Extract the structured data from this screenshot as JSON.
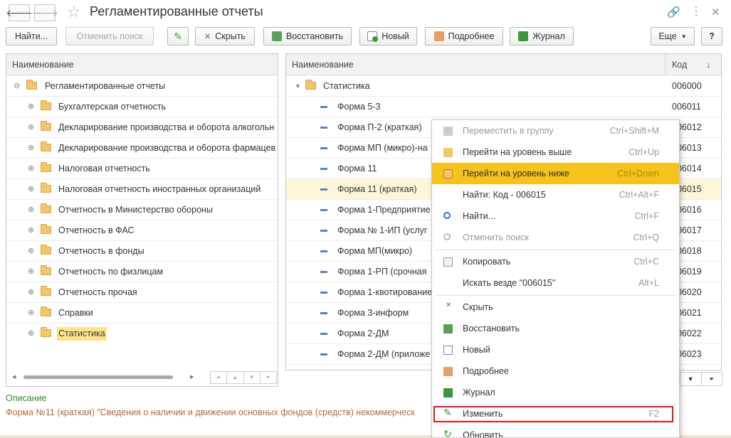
{
  "window": {
    "title": "Регламентированные отчеты"
  },
  "toolbar": {
    "find": "Найти...",
    "cancel_search": "Отменить поиск",
    "hide": "Скрыть",
    "restore": "Восстановить",
    "new": "Новый",
    "details": "Подробнее",
    "journal": "Журнал",
    "more": "Еще",
    "help": "?"
  },
  "left_tree": {
    "header": "Наименование",
    "items": [
      {
        "label": "Регламентированные отчеты"
      },
      {
        "label": "Бухгалтерская отчетность"
      },
      {
        "label": "Декларирование производства и оборота алкогольн"
      },
      {
        "label": "Декларирование производства и оборота фармацев"
      },
      {
        "label": "Налоговая отчетность"
      },
      {
        "label": "Налоговая отчетность иностранных организаций"
      },
      {
        "label": "Отчетность в Министерство обороны"
      },
      {
        "label": "Отчетность в ФАС"
      },
      {
        "label": "Отчетность в фонды"
      },
      {
        "label": "Отчетность по физлицам"
      },
      {
        "label": "Отчетность прочая"
      },
      {
        "label": "Справки"
      },
      {
        "label": "Статистика"
      }
    ]
  },
  "right_list": {
    "header_name": "Наименование",
    "header_code": "Код",
    "sort_icon": "↓",
    "rows": [
      {
        "name": "Статистика",
        "code": "006000"
      },
      {
        "name": "Форма 5-3",
        "code": "006011"
      },
      {
        "name": "Форма П-2 (краткая)",
        "code": "006012"
      },
      {
        "name": "Форма МП (микро)-на",
        "code": "006013"
      },
      {
        "name": "Форма 11",
        "code": "006014"
      },
      {
        "name": "Форма 11 (краткая)",
        "code": "006015"
      },
      {
        "name": "Форма 1-Предприятие",
        "code": "006016"
      },
      {
        "name": "Форма № 1-ИП (услуг",
        "code": "006017"
      },
      {
        "name": "Форма МП(микро)",
        "code": "006018"
      },
      {
        "name": "Форма 1-РП (срочная",
        "code": "006019"
      },
      {
        "name": "Форма 1-квотирование",
        "code": "006020"
      },
      {
        "name": "Форма 3-информ",
        "code": "006021"
      },
      {
        "name": "Форма 2-ДМ",
        "code": "006022"
      },
      {
        "name": "Форма 2-ДМ (приложе",
        "code": "006023"
      }
    ]
  },
  "context_menu": {
    "items": [
      {
        "label": "Переместить в группу",
        "key": "Ctrl+Shift+M"
      },
      {
        "label": "Перейти на уровень выше",
        "key": "Ctrl+Up"
      },
      {
        "label": "Перейти на уровень ниже",
        "key": "Ctrl+Down"
      },
      {
        "label": "Найти: Код - 006015",
        "key": "Ctrl+Alt+F"
      },
      {
        "label": "Найти...",
        "key": "Ctrl+F"
      },
      {
        "label": "Отменить поиск",
        "key": "Ctrl+Q"
      },
      {
        "label": "Копировать",
        "key": "Ctrl+C"
      },
      {
        "label": "Искать везде \"006015\"",
        "key": "Alt+L"
      },
      {
        "label": "Скрыть",
        "key": ""
      },
      {
        "label": "Восстановить",
        "key": ""
      },
      {
        "label": "Новый",
        "key": ""
      },
      {
        "label": "Подробнее",
        "key": ""
      },
      {
        "label": "Журнал",
        "key": ""
      },
      {
        "label": "Изменить",
        "key": "F2"
      },
      {
        "label": "Обновить",
        "key": ""
      }
    ]
  },
  "description": {
    "label": "Описание",
    "text": "Форма №11 (краткая) \"Сведения о наличии и движении основных фондов (средств) некоммерческ"
  },
  "colors": {
    "highlight": "#f5c31c",
    "selected_row": "#fdf6d8",
    "red_frame": "#e0141c",
    "description_label": "#3a8a2a",
    "description_text": "#b2693d"
  }
}
